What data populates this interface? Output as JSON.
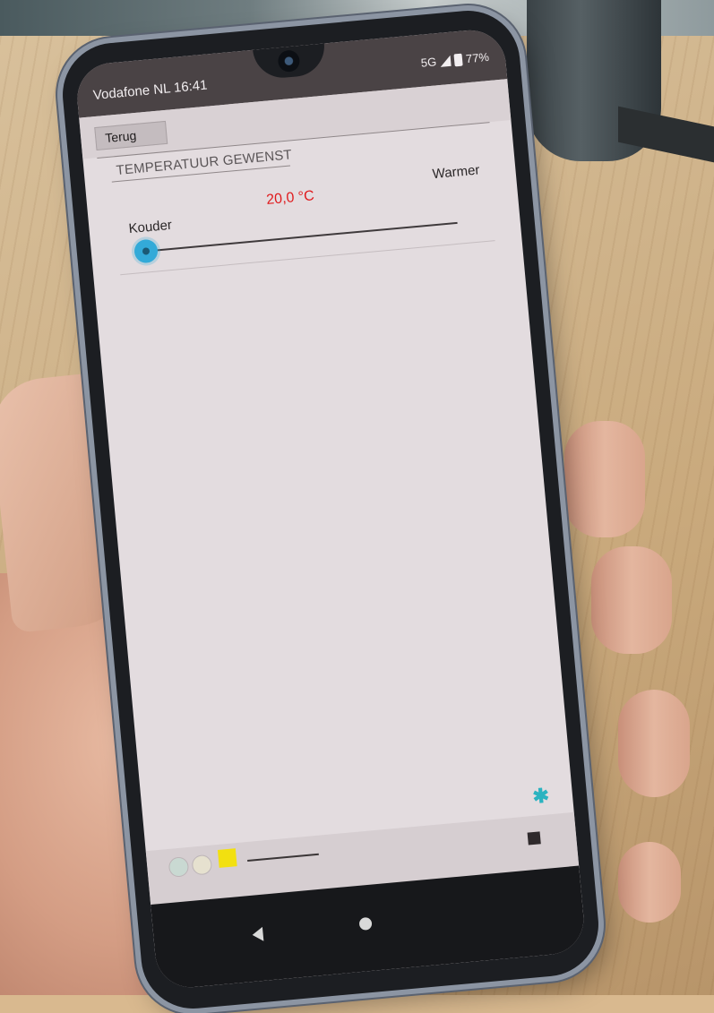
{
  "status_bar": {
    "carrier": "Vodafone NL",
    "time": "16:41",
    "network": "5G",
    "battery": "77%"
  },
  "app": {
    "back_label": "Terug",
    "section_title": "TEMPERATUUR GEWENST",
    "temperature_value": "20,0",
    "temperature_unit": "°C",
    "label_cold": "Kouder",
    "label_warm": "Warmer",
    "slider_level": 0.0
  },
  "footer": {
    "bluetooth_icon": "bluetooth-icon"
  },
  "colors": {
    "temperature_text": "#e0191c",
    "slider_thumb": "#33aad8",
    "bluetooth": "#2bb3c0",
    "indicator_yellow": "#f2e010"
  }
}
